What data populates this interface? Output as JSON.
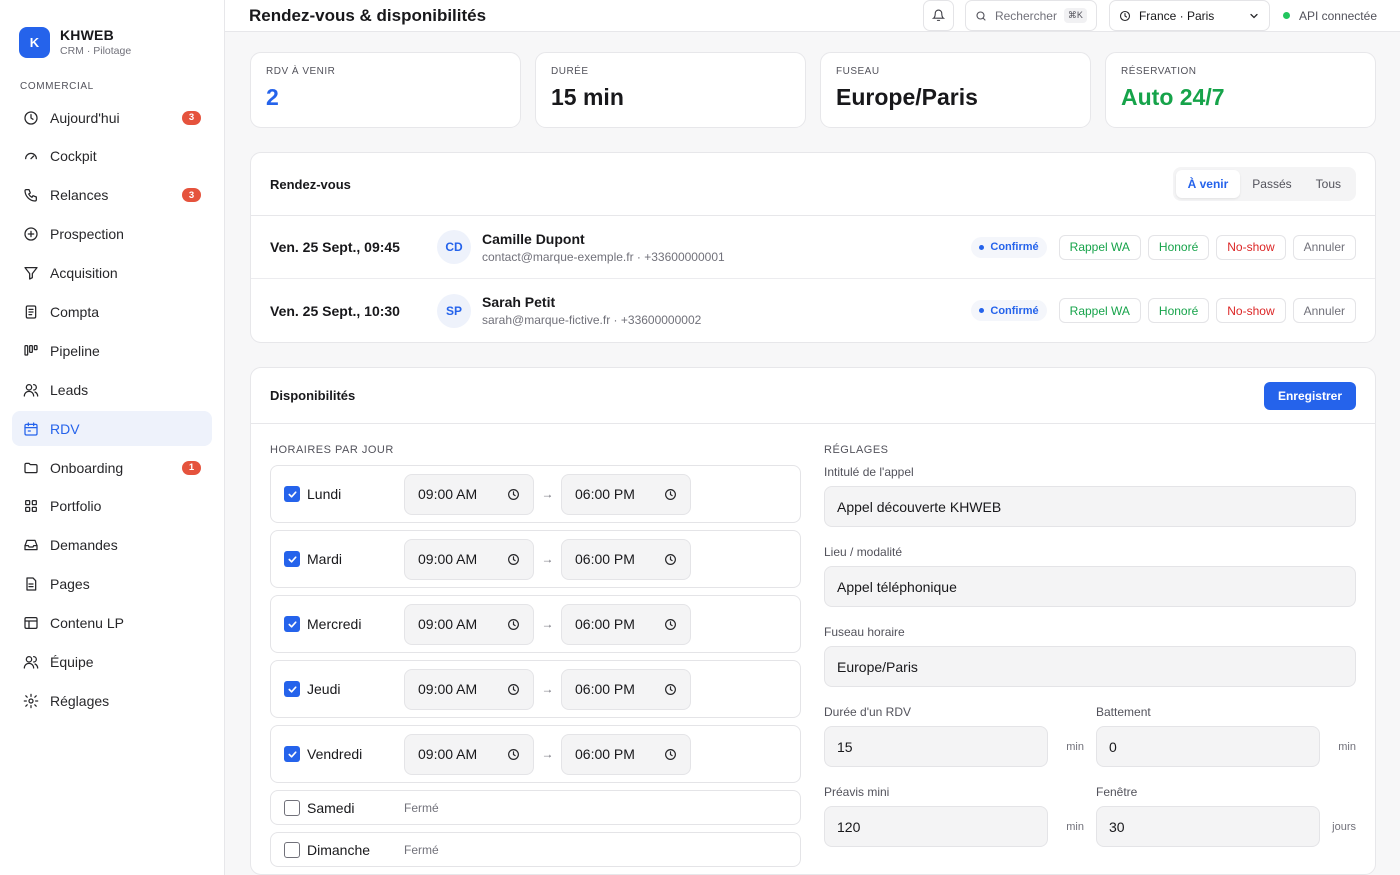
{
  "brand": {
    "logo_letter": "K",
    "name": "KHWEB",
    "subtitle": "CRM · Pilotage"
  },
  "sidebar": {
    "section_label": "COMMERCIAL",
    "items": [
      {
        "label": "Aujourd'hui",
        "icon": "clock-icon",
        "badge": "3"
      },
      {
        "label": "Cockpit",
        "icon": "gauge-icon"
      },
      {
        "label": "Relances",
        "icon": "phone-icon",
        "badge": "3"
      },
      {
        "label": "Prospection",
        "icon": "plus-circle-icon"
      },
      {
        "label": "Acquisition",
        "icon": "filter-icon"
      },
      {
        "label": "Compta",
        "icon": "receipt-icon"
      },
      {
        "label": "Pipeline",
        "icon": "kanban-icon"
      },
      {
        "label": "Leads",
        "icon": "users-icon"
      },
      {
        "label": "RDV",
        "icon": "calendar-icon",
        "active": true
      },
      {
        "label": "Onboarding",
        "icon": "folder-icon",
        "badge": "1"
      },
      {
        "label": "Portfolio",
        "icon": "grid-icon"
      },
      {
        "label": "Demandes",
        "icon": "inbox-icon"
      },
      {
        "label": "Pages",
        "icon": "file-icon"
      },
      {
        "label": "Contenu LP",
        "icon": "layout-icon"
      },
      {
        "label": "Équipe",
        "icon": "team-icon"
      },
      {
        "label": "Réglages",
        "icon": "gear-icon"
      }
    ]
  },
  "topbar": {
    "title": "Rendez-vous & disponibilités",
    "search_placeholder": "Rechercher",
    "search_shortcut": "⌘K",
    "timezone_select": "France · Paris",
    "api_status": "API connectée"
  },
  "stats": [
    {
      "label": "RDV À VENIR",
      "value": "2",
      "color": "blue"
    },
    {
      "label": "DURÉE",
      "value": "15 min",
      "color": "default"
    },
    {
      "label": "FUSEAU",
      "value": "Europe/Paris",
      "color": "default"
    },
    {
      "label": "RÉSERVATION",
      "value": "Auto 24/7",
      "color": "green"
    }
  ],
  "appointments": {
    "title": "Rendez-vous",
    "tabs": [
      "À venir",
      "Passés",
      "Tous"
    ],
    "active_tab": "À venir",
    "actions": {
      "reminder": "Rappel WA",
      "honored": "Honoré",
      "noshow": "No-show",
      "cancel": "Annuler"
    },
    "items": [
      {
        "date": "Ven. 25 Sept., 09:45",
        "initials": "CD",
        "name": "Camille Dupont",
        "contact": "contact@marque-exemple.fr · +33600000001",
        "status": "Confirmé"
      },
      {
        "date": "Ven. 25 Sept., 10:30",
        "initials": "SP",
        "name": "Sarah Petit",
        "contact": "sarah@marque-fictive.fr · +33600000002",
        "status": "Confirmé"
      }
    ]
  },
  "availability": {
    "title": "Disponibilités",
    "save_label": "Enregistrer",
    "hours_label": "HORAIRES PAR JOUR",
    "closed_label": "Fermé",
    "days": [
      {
        "name": "Lundi",
        "enabled": true,
        "start": "09:00 AM",
        "end": "06:00 PM"
      },
      {
        "name": "Mardi",
        "enabled": true,
        "start": "09:00 AM",
        "end": "06:00 PM"
      },
      {
        "name": "Mercredi",
        "enabled": true,
        "start": "09:00 AM",
        "end": "06:00 PM"
      },
      {
        "name": "Jeudi",
        "enabled": true,
        "start": "09:00 AM",
        "end": "06:00 PM"
      },
      {
        "name": "Vendredi",
        "enabled": true,
        "start": "09:00 AM",
        "end": "06:00 PM"
      },
      {
        "name": "Samedi",
        "enabled": false
      },
      {
        "name": "Dimanche",
        "enabled": false
      }
    ],
    "settings": {
      "label": "RÉGLAGES",
      "call_title_label": "Intitulé de l'appel",
      "call_title": "Appel découverte KHWEB",
      "location_label": "Lieu / modalité",
      "location": "Appel téléphonique",
      "timezone_label": "Fuseau horaire",
      "timezone": "Europe/Paris",
      "duration_label": "Durée d'un RDV",
      "duration": "15",
      "buffer_label": "Battement",
      "buffer": "0",
      "notice_label": "Préavis mini",
      "notice": "120",
      "window_label": "Fenêtre",
      "window": "30",
      "unit_min": "min",
      "unit_days": "jours"
    }
  },
  "colors": {
    "accent": "#2563eb",
    "success": "#16a34a",
    "danger": "#dc2626",
    "badge": "#e5533d"
  }
}
